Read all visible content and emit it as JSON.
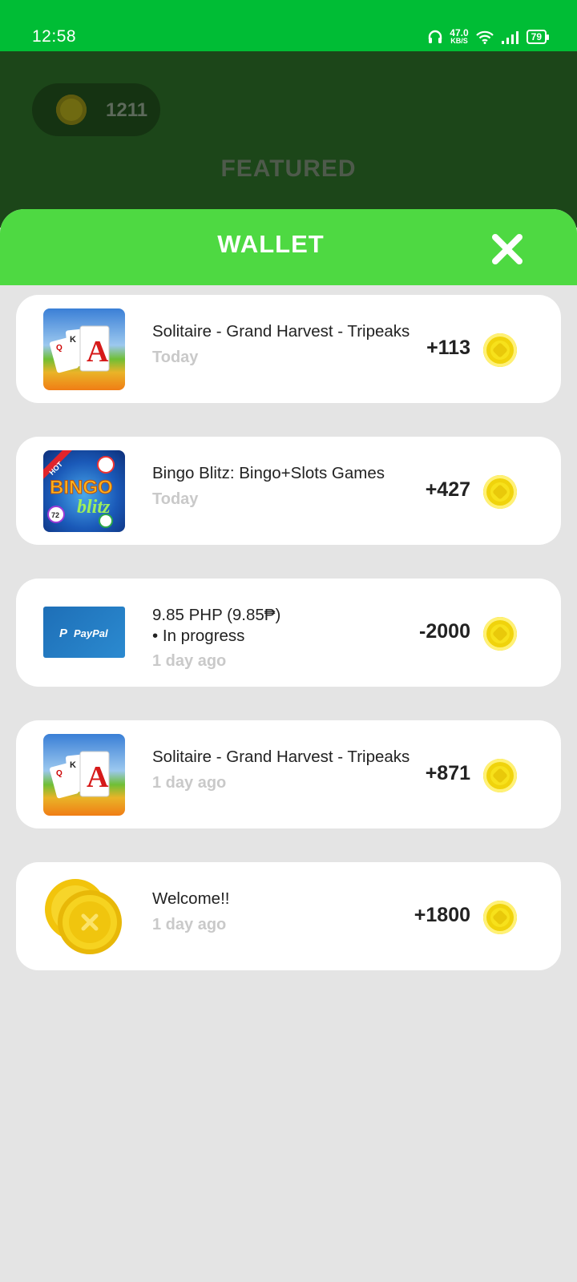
{
  "status_bar": {
    "time": "12:58",
    "net_speed_value": "47.0",
    "net_speed_unit": "KB/S",
    "battery": "79",
    "icons": [
      "headphones-icon",
      "wifi-icon",
      "signal-icon",
      "battery-icon"
    ]
  },
  "background": {
    "coin_balance": "1211",
    "section_title": "FEATURED"
  },
  "wallet": {
    "title": "WALLET",
    "close_icon": "close-icon",
    "items": [
      {
        "title": "Solitaire - Grand Harvest - Tripeaks",
        "status": "",
        "time": "Today",
        "amount": "+113",
        "icon": "solitaire-app-icon"
      },
      {
        "title": "Bingo Blitz: Bingo+Slots Games",
        "status": "",
        "time": "Today",
        "amount": "+427",
        "icon": "bingo-blitz-app-icon"
      },
      {
        "title": "9.85 PHP (9.85₱)",
        "status": "• In progress",
        "time": "1 day ago",
        "amount": "-2000",
        "icon": "paypal-icon"
      },
      {
        "title": "Solitaire - Grand Harvest - Tripeaks",
        "status": "",
        "time": "1 day ago",
        "amount": "+871",
        "icon": "solitaire-app-icon"
      },
      {
        "title": "Welcome!!",
        "status": "",
        "time": "1 day ago",
        "amount": "+1800",
        "icon": "gold-coins-icon"
      }
    ]
  },
  "colors": {
    "status_bar": "#00bd35",
    "wallet_header": "#4ed942",
    "dimmed_background": "#1c4619",
    "sheet_background": "#e4e4e4",
    "coin": "#f7e11b"
  }
}
